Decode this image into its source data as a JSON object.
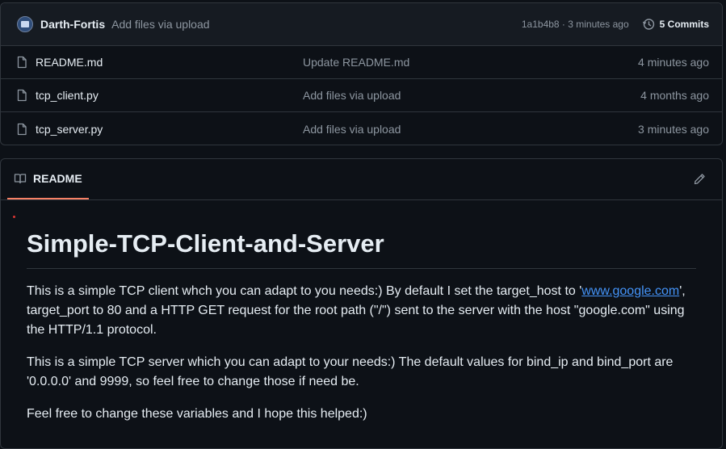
{
  "latest_commit": {
    "author": "Darth-Fortis",
    "message": "Add files via upload",
    "meta": "1a1b4b8 · 3 minutes ago",
    "commits_label": "5 Commits"
  },
  "files": [
    {
      "name": "README.md",
      "commit": "Update README.md",
      "time": "4 minutes ago"
    },
    {
      "name": "tcp_client.py",
      "commit": "Add files via upload",
      "time": "4 months ago"
    },
    {
      "name": "tcp_server.py",
      "commit": "Add files via upload",
      "time": "3 minutes ago"
    }
  ],
  "readme": {
    "tab_label": "README",
    "title": "Simple-TCP-Client-and-Server",
    "p1_before": "This is a simple TCP client whch you can adapt to you needs:) By default I set the target_host to '",
    "p1_link": "www.google.com",
    "p1_after": "', target_port to 80 and a HTTP GET request for the root path (\"/\") sent to the server with the host \"google.com\" using the HTTP/1.1 protocol.",
    "p2": "This is a simple TCP server which you can adapt to your needs:) The default values for bind_ip and bind_port are '0.0.0.0' and 9999, so feel free to change those if need be.",
    "p3": "Feel free to change these variables and I hope this helped:)"
  },
  "colors": {
    "background": "#0d1117",
    "border": "#30363d",
    "muted_text": "#8d96a0",
    "link": "#4493f8",
    "tab_underline": "#f78166"
  }
}
